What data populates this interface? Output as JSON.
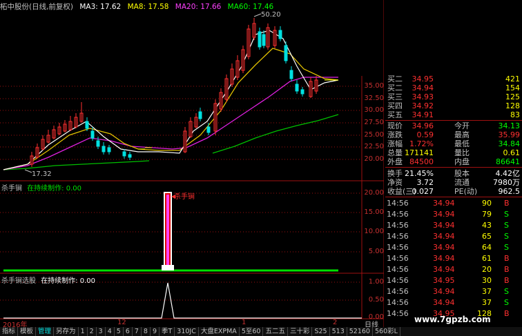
{
  "header": {
    "stock_title": "柘中股份(日线,前复权)",
    "ma3": "MA3: 17.62",
    "ma8": "MA8: 17.58",
    "ma20": "MA20: 17.66",
    "ma60": "MA60: 17.46",
    "colors": {
      "ma3": "#ffffff",
      "ma8": "#ffff00",
      "ma20": "#ff40ff",
      "ma60": "#00ff00"
    }
  },
  "price_panel": {
    "high_label": "50.20",
    "low_label": "17.32",
    "y_axis": [
      "35.00",
      "32.50",
      "30.00",
      "27.50",
      "25.00",
      "22.50",
      "20.00"
    ]
  },
  "indicator1": {
    "title": "杀手锏",
    "status": "在持续制作: 0.00",
    "signal_label": "杀手锏",
    "y_axis": [
      "20.00",
      "15.00",
      "10.00",
      "5.00"
    ]
  },
  "indicator2": {
    "title": "杀手锏选股",
    "status": "在持续制作: 0.00",
    "y_axis": [
      "1.00",
      "0.50",
      "0.00"
    ]
  },
  "date_bar": {
    "year": "2016年",
    "m12": "12",
    "m1": "1",
    "m2": "2",
    "period": "日线"
  },
  "quote": {
    "bid_ask": [
      {
        "label": "买二",
        "price": "34.95",
        "vol": "421"
      },
      {
        "label": "买二",
        "price": "34.94",
        "vol": "154"
      },
      {
        "label": "买三",
        "price": "34.93",
        "vol": "125"
      },
      {
        "label": "买四",
        "price": "34.92",
        "vol": "128"
      },
      {
        "label": "买五",
        "price": "34.91",
        "vol": "83"
      }
    ],
    "stats": [
      {
        "l1": "现价",
        "v1": "34.96",
        "l2": "今开",
        "v2": "34.13"
      },
      {
        "l1": "涨跌",
        "v1": "0.59",
        "l2": "最高",
        "v2": "35.99"
      },
      {
        "l1": "涨幅",
        "v1": "1.72%",
        "l2": "最低",
        "v2": "34.84"
      },
      {
        "l1": "总量",
        "v1": "171141",
        "l2": "量比",
        "v2": "0.61"
      },
      {
        "l1": "外盘",
        "v1": "84500",
        "l2": "内盘",
        "v2": "86641"
      }
    ],
    "stats2": [
      {
        "l1": "换手",
        "v1": "21.45%",
        "l2": "股本",
        "v2": "4.42亿"
      },
      {
        "l1": "净资",
        "v1": "3.72",
        "l2": "流通",
        "v2": "7980万"
      },
      {
        "l1": "收益(三)",
        "v1": "0.027",
        "l2": "PE(动)",
        "v2": "962.5"
      }
    ]
  },
  "ticks": [
    {
      "time": "14:56",
      "price": "34.94",
      "vol": "90",
      "side": "B"
    },
    {
      "time": "14:56",
      "price": "34.94",
      "vol": "79",
      "side": "S"
    },
    {
      "time": "14:56",
      "price": "34.94",
      "vol": "43",
      "side": "S"
    },
    {
      "time": "14:56",
      "price": "34.94",
      "vol": "65",
      "side": "S"
    },
    {
      "time": "14:56",
      "price": "34.94",
      "vol": "64",
      "side": "S"
    },
    {
      "time": "14:56",
      "price": "34.94",
      "vol": "61",
      "side": "B"
    },
    {
      "time": "14:56",
      "price": "34.94",
      "vol": "20",
      "side": "B"
    },
    {
      "time": "14:56",
      "price": "34.95",
      "vol": "30",
      "side": "B"
    },
    {
      "time": "14:56",
      "price": "34.94",
      "vol": "37",
      "side": "S"
    },
    {
      "time": "14:56",
      "price": "34.94",
      "vol": "37",
      "side": "S"
    },
    {
      "time": "14:56",
      "price": "34.95",
      "vol": "128",
      "side": "B"
    }
  ],
  "tabs": [
    "指标",
    "模板",
    "管理",
    "另存为",
    "1",
    "2",
    "3",
    "4",
    "5",
    "6",
    "7",
    "8",
    "9",
    "季T",
    "310JC",
    "大盘EXPMA",
    "5至60",
    "五二五",
    "三十彩",
    "S25",
    "513",
    "52160",
    "560彩L"
  ],
  "watermark": "www.7gpzb.com"
}
